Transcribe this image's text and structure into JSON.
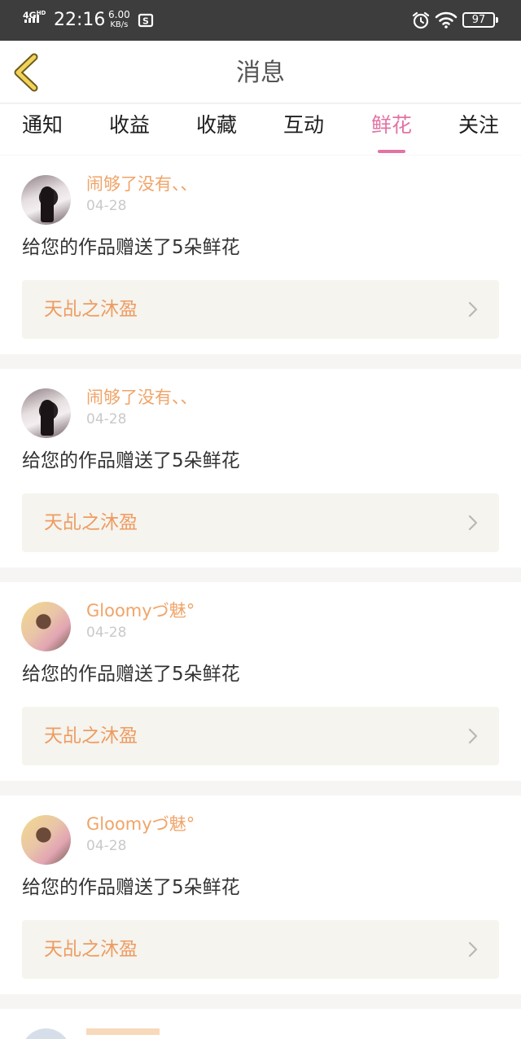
{
  "status_bar": {
    "network": "4G",
    "network_sup": "HD",
    "time": "22:16",
    "net_speed": "6.00",
    "net_speed_unit": "KB/s",
    "battery": "97"
  },
  "header": {
    "title": "消息",
    "back_icon": "chevron-left-icon"
  },
  "tabs": [
    {
      "label": "通知",
      "active": false
    },
    {
      "label": "收益",
      "active": false
    },
    {
      "label": "收藏",
      "active": false
    },
    {
      "label": "互动",
      "active": false
    },
    {
      "label": "鲜花",
      "active": true
    },
    {
      "label": "关注",
      "active": false
    }
  ],
  "colors": {
    "accent": "#e274a5",
    "username": "#f0a468",
    "link": "#ee9b61",
    "link_box_bg": "#f5f4ee",
    "status_bar_bg": "#3d3d3d"
  },
  "messages": [
    {
      "username": "闹够了没有、、",
      "date": "04-28",
      "text": "给您的作品赠送了5朵鲜花",
      "work_title": "天乩之沐盈"
    },
    {
      "username": "闹够了没有、、",
      "date": "04-28",
      "text": "给您的作品赠送了5朵鲜花",
      "work_title": "天乩之沐盈"
    },
    {
      "username": "Gloomyづ魅°",
      "date": "04-28",
      "text": "给您的作品赠送了5朵鲜花",
      "work_title": "天乩之沐盈"
    },
    {
      "username": "Gloomyづ魅°",
      "date": "04-28",
      "text": "给您的作品赠送了5朵鲜花",
      "work_title": "天乩之沐盈"
    }
  ]
}
